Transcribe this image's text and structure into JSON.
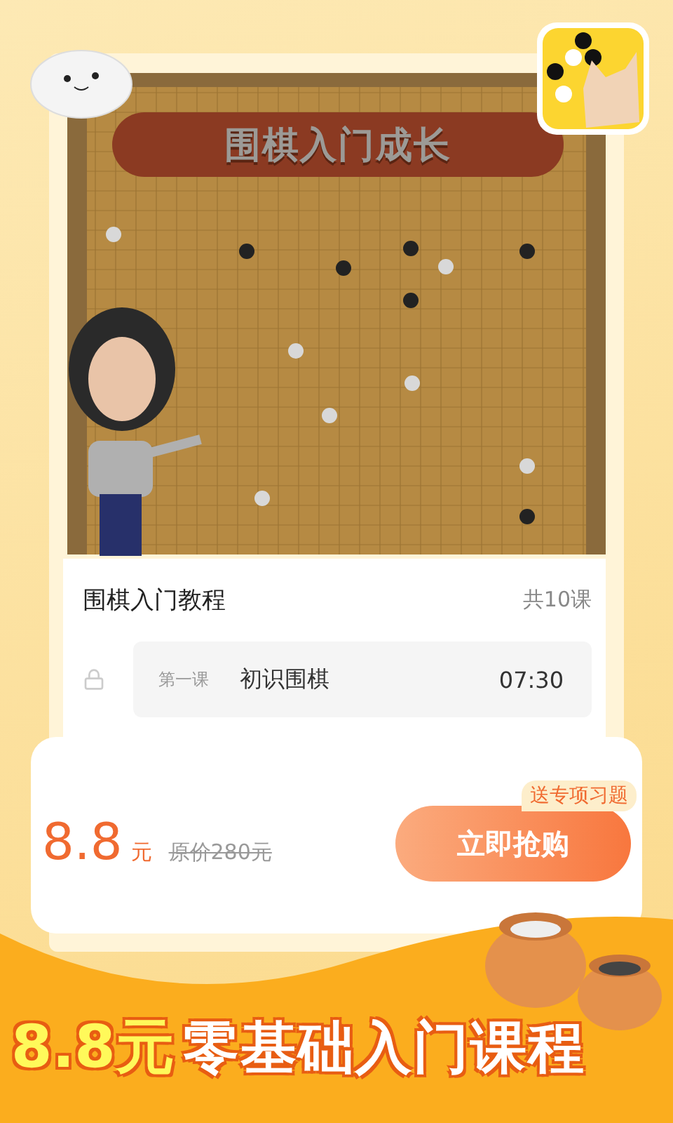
{
  "board": {
    "banner_title": "围棋入门成长"
  },
  "course": {
    "title": "围棋入门教程",
    "count": "共10课",
    "lessons": [
      {
        "number": "第一课",
        "title": "初识围棋",
        "duration": "07:30",
        "locked": true
      }
    ]
  },
  "purchase": {
    "price": "8.8",
    "unit": "元",
    "original_price": "原价280元",
    "tag": "送专项习题",
    "button": "立即抢购"
  },
  "promo": {
    "price": "8.8元",
    "text": "零基础入门课程"
  }
}
